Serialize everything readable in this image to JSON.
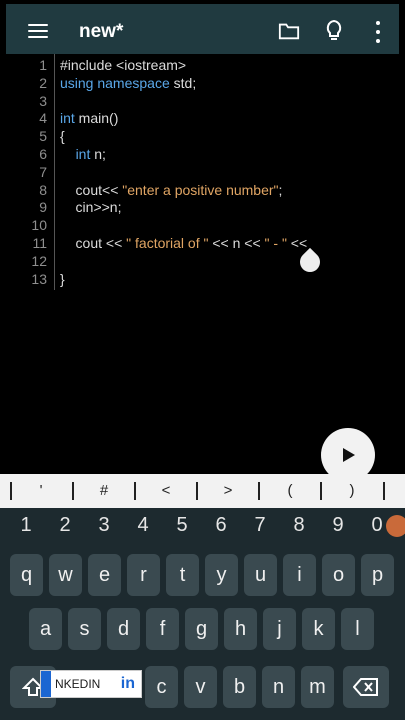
{
  "header": {
    "title": "new*"
  },
  "editor": {
    "lines": [
      {
        "num": "1",
        "text": "#include <iostream>"
      },
      {
        "num": "2",
        "text": "using namespace std;"
      },
      {
        "num": "3",
        "text": ""
      },
      {
        "num": "4",
        "text": "int main()"
      },
      {
        "num": "5",
        "text": "{"
      },
      {
        "num": "6",
        "text": "    int n;"
      },
      {
        "num": "7",
        "text": ""
      },
      {
        "num": "8",
        "text": "    cout<< \"enter a positive number\";"
      },
      {
        "num": "9",
        "text": "    cin>>n;"
      },
      {
        "num": "10",
        "text": ""
      },
      {
        "num": "11",
        "text": "    cout << \" factorial of \" << n << \" - \" <<"
      },
      {
        "num": "12",
        "text": ""
      },
      {
        "num": "13",
        "text": "}"
      }
    ]
  },
  "keyboard": {
    "symbols": [
      "'",
      "#",
      "<",
      ">",
      "(",
      ")"
    ],
    "numbers": [
      "1",
      "2",
      "3",
      "4",
      "5",
      "6",
      "7",
      "8",
      "9",
      "0"
    ],
    "row1": [
      "q",
      "w",
      "e",
      "r",
      "t",
      "y",
      "u",
      "i",
      "o",
      "p"
    ],
    "row2": [
      "a",
      "s",
      "d",
      "f",
      "g",
      "h",
      "j",
      "k",
      "l"
    ],
    "row3": [
      "c",
      "v",
      "b",
      "n",
      "m"
    ],
    "linkedin_text": "NKEDIN",
    "linkedin_in": "in"
  }
}
